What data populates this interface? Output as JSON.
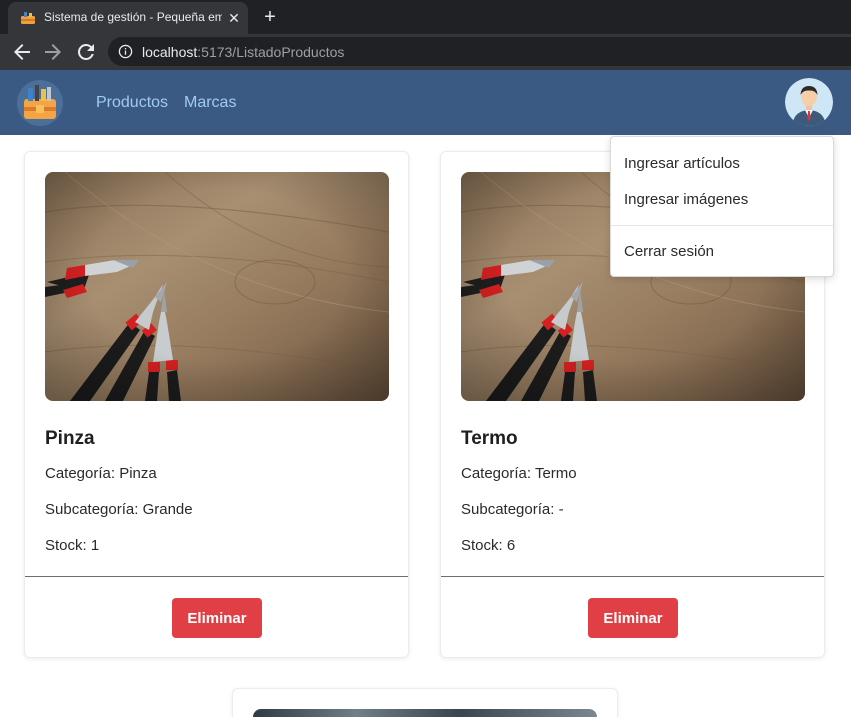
{
  "browser": {
    "tab_title": "Sistema de gestión - Pequeña em",
    "tab_close": "✕",
    "new_tab": "+",
    "url_host": "localhost",
    "url_rest": ":5173/ListadoProductos"
  },
  "navbar": {
    "links": [
      "Productos",
      "Marcas"
    ]
  },
  "dropdown": {
    "items": [
      "Ingresar artículos",
      "Ingresar imágenes",
      "Cerrar sesión"
    ]
  },
  "products": [
    {
      "name": "Pinza",
      "categoria": "Categoría: Pinza",
      "subcategoria": "Subcategoría: Grande",
      "stock": "Stock: 1",
      "button": "Eliminar"
    },
    {
      "name": "Termo",
      "categoria": "Categoría: Termo",
      "subcategoria": "Subcategoría: -",
      "stock": "Stock: 6",
      "button": "Eliminar"
    }
  ],
  "colors": {
    "navbar": "#3b5a83",
    "nav_link": "#9fcbf0",
    "delete_button": "#e04045"
  },
  "icons": [
    "back-arrow-icon",
    "forward-arrow-icon",
    "reload-icon",
    "info-icon",
    "toolbox-logo-icon",
    "user-avatar-icon"
  ]
}
